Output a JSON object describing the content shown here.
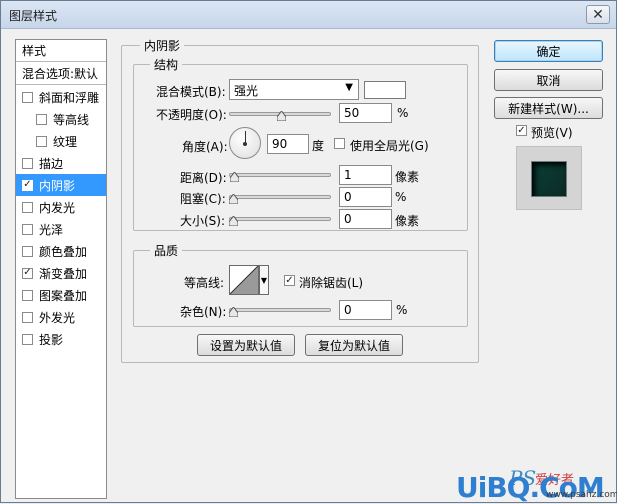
{
  "window": {
    "title": "图层样式",
    "close_glyph": "✕"
  },
  "left_panel": {
    "header_styles": "样式",
    "header_blend": "混合选项:默认",
    "items": [
      {
        "label": "斜面和浮雕",
        "checked": false,
        "sub": false,
        "selected": false
      },
      {
        "label": "等高线",
        "checked": false,
        "sub": true,
        "selected": false
      },
      {
        "label": "纹理",
        "checked": false,
        "sub": true,
        "selected": false
      },
      {
        "label": "描边",
        "checked": false,
        "sub": false,
        "selected": false
      },
      {
        "label": "内阴影",
        "checked": true,
        "sub": false,
        "selected": true
      },
      {
        "label": "内发光",
        "checked": false,
        "sub": false,
        "selected": false
      },
      {
        "label": "光泽",
        "checked": false,
        "sub": false,
        "selected": false
      },
      {
        "label": "颜色叠加",
        "checked": false,
        "sub": false,
        "selected": false
      },
      {
        "label": "渐变叠加",
        "checked": true,
        "sub": false,
        "selected": false
      },
      {
        "label": "图案叠加",
        "checked": false,
        "sub": false,
        "selected": false
      },
      {
        "label": "外发光",
        "checked": false,
        "sub": false,
        "selected": false
      },
      {
        "label": "投影",
        "checked": false,
        "sub": false,
        "selected": false
      }
    ]
  },
  "inner_shadow": {
    "title": "内阴影",
    "structure": {
      "title": "结构",
      "blend_mode_label": "混合模式(B):",
      "blend_mode_value": "强光",
      "swatch_color": "#ffffff",
      "opacity_label": "不透明度(O):",
      "opacity_value": "50",
      "opacity_unit": "%",
      "angle_label": "角度(A):",
      "angle_value": "90",
      "angle_unit": "度",
      "global_light_label": "使用全局光(G)",
      "global_light_checked": false,
      "distance_label": "距离(D):",
      "distance_value": "1",
      "distance_unit": "像素",
      "choke_label": "阻塞(C):",
      "choke_value": "0",
      "choke_unit": "%",
      "size_label": "大小(S):",
      "size_value": "0",
      "size_unit": "像素"
    },
    "quality": {
      "title": "品质",
      "contour_label": "等高线:",
      "anti_alias_label": "消除锯齿(L)",
      "anti_alias_checked": true,
      "noise_label": "杂色(N):",
      "noise_value": "0",
      "noise_unit": "%"
    },
    "make_default": "设置为默认值",
    "reset_default": "复位为默认值"
  },
  "right_buttons": {
    "ok": "确定",
    "cancel": "取消",
    "new_style": "新建样式(W)...",
    "preview_label": "预览(V)",
    "preview_checked": true
  },
  "watermark": {
    "ps_mark": "PS",
    "cn_text": "爱好者",
    "uibq": "UiBQ.CoM",
    "url": "www.psahz.com"
  }
}
